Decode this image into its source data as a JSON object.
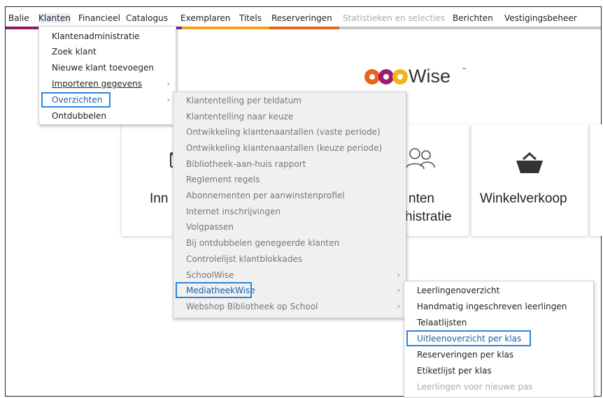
{
  "menubar": {
    "items": [
      {
        "label": "Balie"
      },
      {
        "label": "Klanten"
      },
      {
        "label": "Financieel"
      },
      {
        "label": "Catalogus"
      },
      {
        "label": "Exemplaren"
      },
      {
        "label": "Titels"
      },
      {
        "label": "Reserveringen"
      },
      {
        "label": "Statistieken en selecties"
      },
      {
        "label": "Berichten"
      },
      {
        "label": "Vestigingsbeheer"
      }
    ],
    "accent_colors": [
      "#8e1b5f",
      "#6a2c91",
      "#f0a21b",
      "#e8641b",
      "#c8c8c8"
    ]
  },
  "logo": {
    "text": "Wise",
    "tm": "™",
    "colors": [
      "#e8641b",
      "#9b1d73",
      "#f2b21b"
    ]
  },
  "tiles": [
    {
      "label": "Inn",
      "icon": "box-icon"
    },
    {
      "label_line1": "nten",
      "label_line2": "histratie",
      "icon": "people-icon"
    },
    {
      "label": "Winkelverkoop",
      "icon": "basket-icon"
    }
  ],
  "klanten_menu": [
    {
      "label": "Klantenadministratie"
    },
    {
      "label": "Zoek klant"
    },
    {
      "label": "Nieuwe klant toevoegen"
    },
    {
      "label": "Importeren gegevens",
      "submenu": true
    },
    {
      "label": "Overzichten",
      "submenu": true,
      "selected": true
    },
    {
      "label": "Ontdubbelen"
    }
  ],
  "overzichten_menu": [
    {
      "label": "Klantentelling per teldatum"
    },
    {
      "label": "Klantentelling naar keuze"
    },
    {
      "label": "Ontwikkeling klantenaantallen (vaste periode)"
    },
    {
      "label": "Ontwikkeling klantenaantallen (keuze periode)"
    },
    {
      "label": "Bibliotheek-aan-huis rapport"
    },
    {
      "label": "Reglement regels"
    },
    {
      "label": "Abonnementen per aanwinstenprofiel"
    },
    {
      "label": "Internet inschrijvingen"
    },
    {
      "label": "Volgpassen"
    },
    {
      "label": "Bij ontdubbelen genegeerde klanten"
    },
    {
      "label": "Controlelijst klantblokkades"
    },
    {
      "label": "SchoolWise",
      "submenu": true
    },
    {
      "label": "MediatheekWise",
      "submenu": true,
      "selected": true
    },
    {
      "label": "Webshop Bibliotheek op School",
      "submenu": true
    }
  ],
  "mediatheek_menu": [
    {
      "label": "Leerlingenoverzicht"
    },
    {
      "label": "Handmatig ingeschreven leerlingen"
    },
    {
      "label": "Telaatlijsten"
    },
    {
      "label": "Uitleenoverzicht per klas",
      "selected": true
    },
    {
      "label": "Reserveringen per klas"
    },
    {
      "label": "Etiketlijst per klas"
    },
    {
      "label": "Leerlingen voor nieuwe pas",
      "disabled": true
    }
  ],
  "submenu_arrow": "›"
}
